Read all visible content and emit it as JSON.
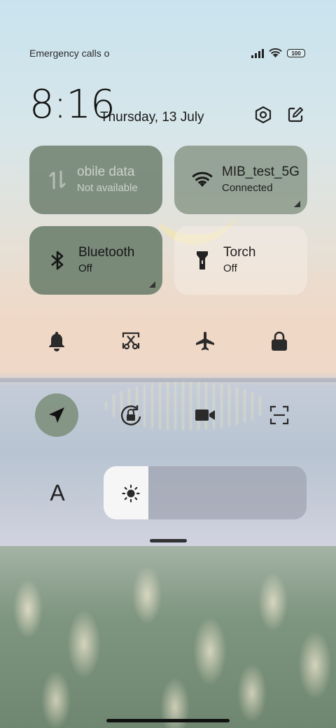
{
  "status_bar": {
    "carrier_text": "Emergency calls o",
    "signal_icon": "signal-icon",
    "wifi_icon": "wifi-icon",
    "battery_level": "100"
  },
  "header": {
    "time": "8:16",
    "date": "Thursday, 13 July",
    "settings_icon": "settings-hexagon-icon",
    "edit_icon": "edit-icon"
  },
  "tiles": {
    "mobile_data": {
      "title": "obile data",
      "subtitle": "Not available",
      "icon": "mobile-data-arrows-icon",
      "active": false
    },
    "wifi": {
      "title": "MIB_test_5G",
      "subtitle": "Connected",
      "icon": "wifi-icon",
      "active": true
    },
    "bluetooth": {
      "title": "Bluetooth",
      "subtitle": "Off",
      "icon": "bluetooth-icon",
      "active": false
    },
    "torch": {
      "title": "Torch",
      "subtitle": "Off",
      "icon": "torch-icon",
      "active": false
    }
  },
  "toggles_row1": [
    "bell-icon",
    "screenshot-scissors-icon",
    "airplane-icon",
    "lock-icon"
  ],
  "toggles_row2": [
    "location-arrow-icon",
    "rotation-lock-icon",
    "video-camera-icon",
    "scanner-icon"
  ],
  "location_active": true,
  "brightness": {
    "level": 0.22,
    "icon": "sun-icon"
  },
  "font_button_label": "A",
  "colors": {
    "tile_active": "#8c9b8c",
    "tile_dark": "#738473",
    "accent_text": "#161616"
  }
}
